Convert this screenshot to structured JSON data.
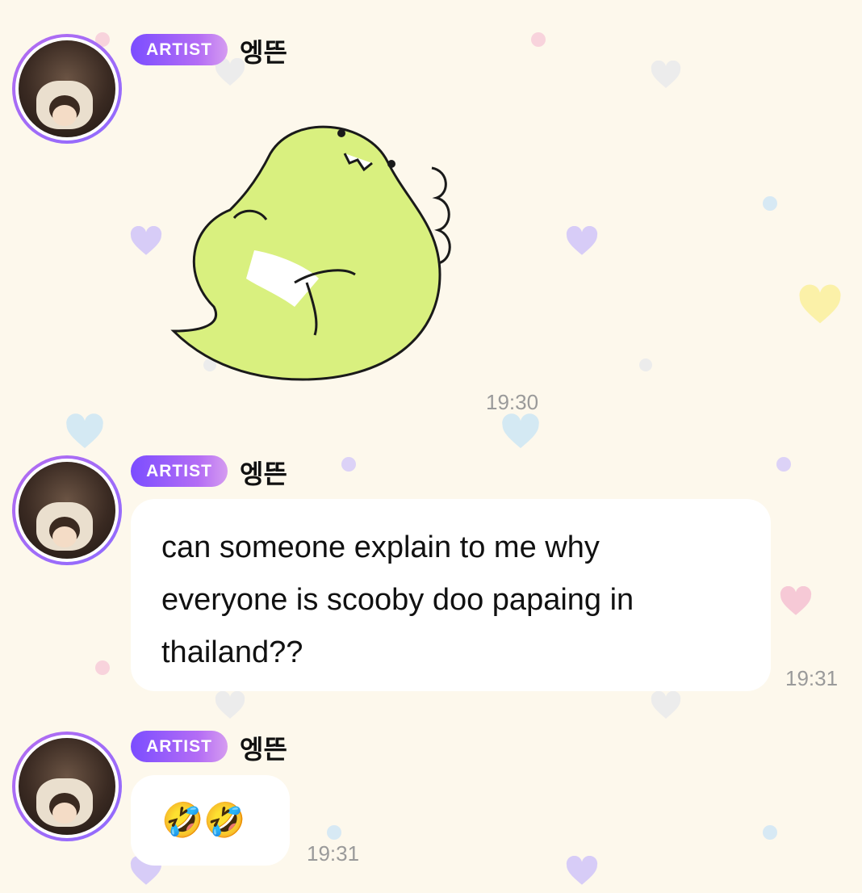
{
  "messages": [
    {
      "badge": "ARTIST",
      "author": "엥뜬",
      "type": "sticker",
      "sticker": "green-dinosaur-sticker",
      "time": "19:30"
    },
    {
      "badge": "ARTIST",
      "author": "엥뜬",
      "type": "text",
      "lines": [
        "can someone explain to me why",
        "everyone is scooby doo papaing in",
        "thailand??"
      ],
      "time": "19:31"
    },
    {
      "badge": "ARTIST",
      "author": "엥뜬",
      "type": "text",
      "text": "🤣🤣",
      "time": "19:31"
    }
  ],
  "colors": {
    "background": "#fdf8ec",
    "badge_start": "#7b4dff",
    "badge_end": "#d59cf0",
    "bubble": "#ffffff",
    "timestamp": "#9a9a9a",
    "sticker_body": "#d9f07f"
  }
}
